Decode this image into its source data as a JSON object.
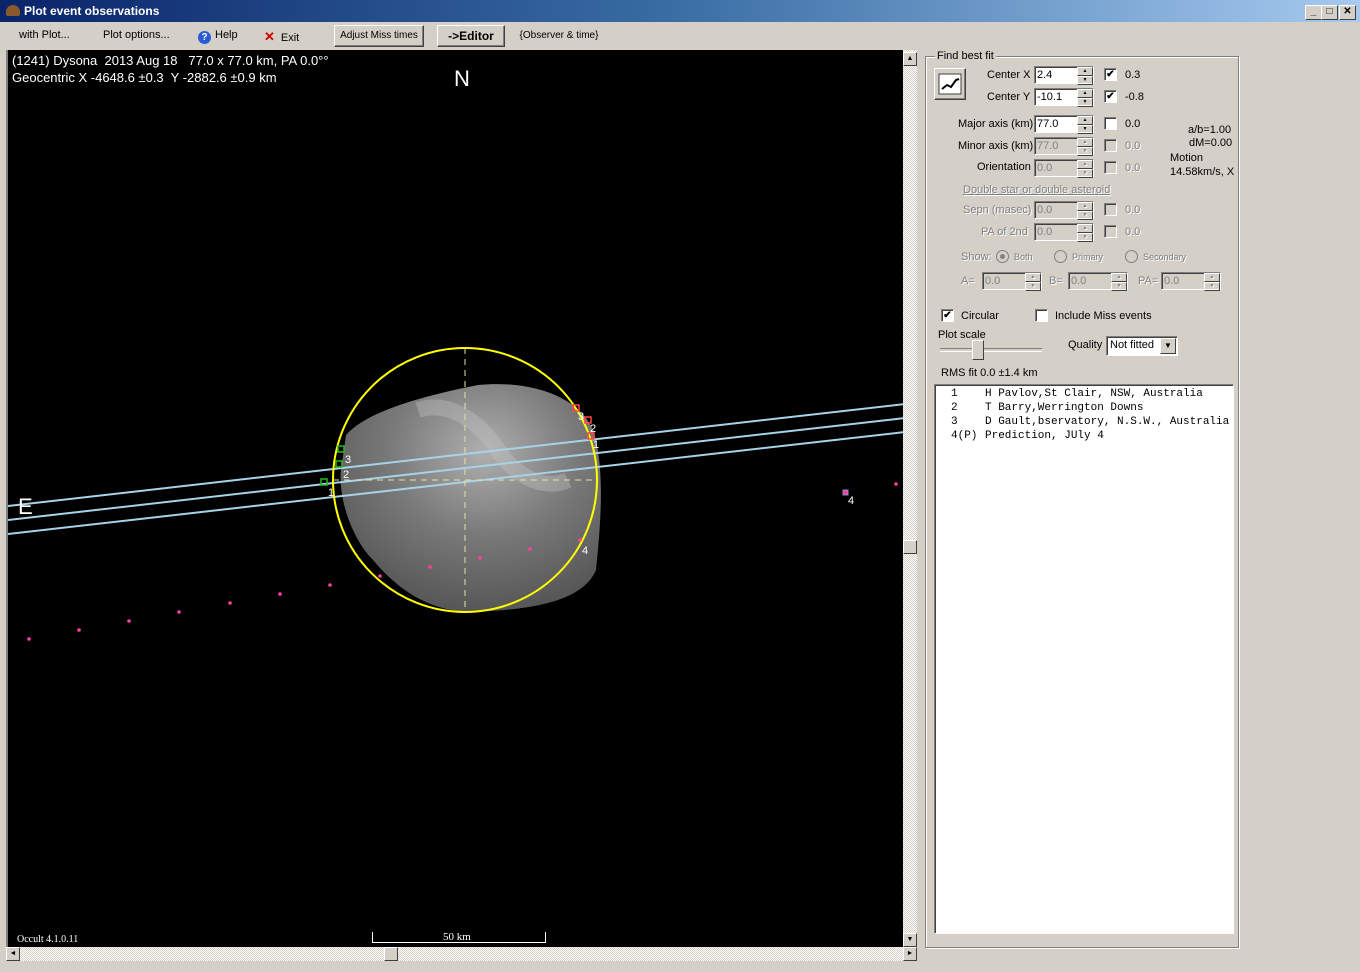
{
  "window": {
    "title": "Plot event observations",
    "controls": [
      "minimize",
      "maximize",
      "close"
    ]
  },
  "menubar": {
    "items": [
      "with Plot...",
      "Plot options...",
      "Help",
      "Exit"
    ],
    "buttons": {
      "adjust_miss": "Adjust Miss times",
      "editor": "->Editor",
      "observer_time": "{Observer & time}"
    }
  },
  "plot": {
    "header_line1": "(1241) Dysona  2013 Aug 18   77.0 x 77.0 km, PA 0.0°°",
    "header_line2": "Geocentric X -4648.6 ±0.3  Y -2882.6 ±0.9 km",
    "north_label": "N",
    "east_label": "E",
    "version": "Occult 4.1.0.11",
    "scale_label": "50 km",
    "chord_labels": [
      "1",
      "2",
      "3"
    ],
    "prediction_label": "4",
    "colors": {
      "background": "#000000",
      "ellipse": "#ffff00",
      "chord": "#a6d3e8",
      "disappear": "#22bb22",
      "reappear": "#ff4444",
      "prediction": "#ff40a0",
      "axes": "#e8e0a0"
    }
  },
  "fit": {
    "group_label": "Find best fit",
    "center_x": {
      "label": "Center X",
      "value": "2.4",
      "checked": true,
      "result": "0.3"
    },
    "center_y": {
      "label": "Center Y",
      "value": "-10.1",
      "checked": true,
      "result": "-0.8"
    },
    "major_axis": {
      "label": "Major axis (km)",
      "value": "77.0",
      "checked": false,
      "result": "0.0"
    },
    "minor_axis": {
      "label": "Minor axis (km)",
      "value": "77.0",
      "checked": false,
      "result": "0.0"
    },
    "orientation": {
      "label": "Orientation",
      "value": "0.0",
      "checked": false,
      "result": "0.0"
    },
    "ab": "a/b=1.00",
    "dm": "dM=0.00",
    "motion_label": "Motion",
    "motion_value": "14.58km/s, X",
    "double_star_label": "Double star  or  double asteroid",
    "sepn": {
      "label": "Sepn (masec)",
      "value": "0.0",
      "result": "0.0"
    },
    "pa2": {
      "label": "PA of 2nd",
      "value": "0.0",
      "result": "0.0"
    },
    "show_label": "Show:",
    "show_options": [
      "Both",
      "Primary",
      "Secondary"
    ],
    "a_label": "A=",
    "a_value": "0.0",
    "b_label": "B=",
    "b_value": "0.0",
    "pa_label": "PA=",
    "pa_value": "0.0",
    "circular_label": "Circular",
    "circular_checked": true,
    "include_miss_label": "Include Miss events",
    "include_miss_checked": false,
    "plot_scale_label": "Plot scale",
    "quality_label": "Quality",
    "quality_value": "Not fitted",
    "rms": "RMS fit 0.0 ±1.4 km"
  },
  "observers": [
    {
      "num": "1",
      "text": "H Pavlov,St Clair, NSW, Australia"
    },
    {
      "num": "2",
      "text": "T Barry,Werrington Downs"
    },
    {
      "num": "3",
      "text": "D Gault,bservatory, N.S.W., Australia"
    },
    {
      "num": "4(P)",
      "text": "Prediction, JUly 4"
    }
  ]
}
